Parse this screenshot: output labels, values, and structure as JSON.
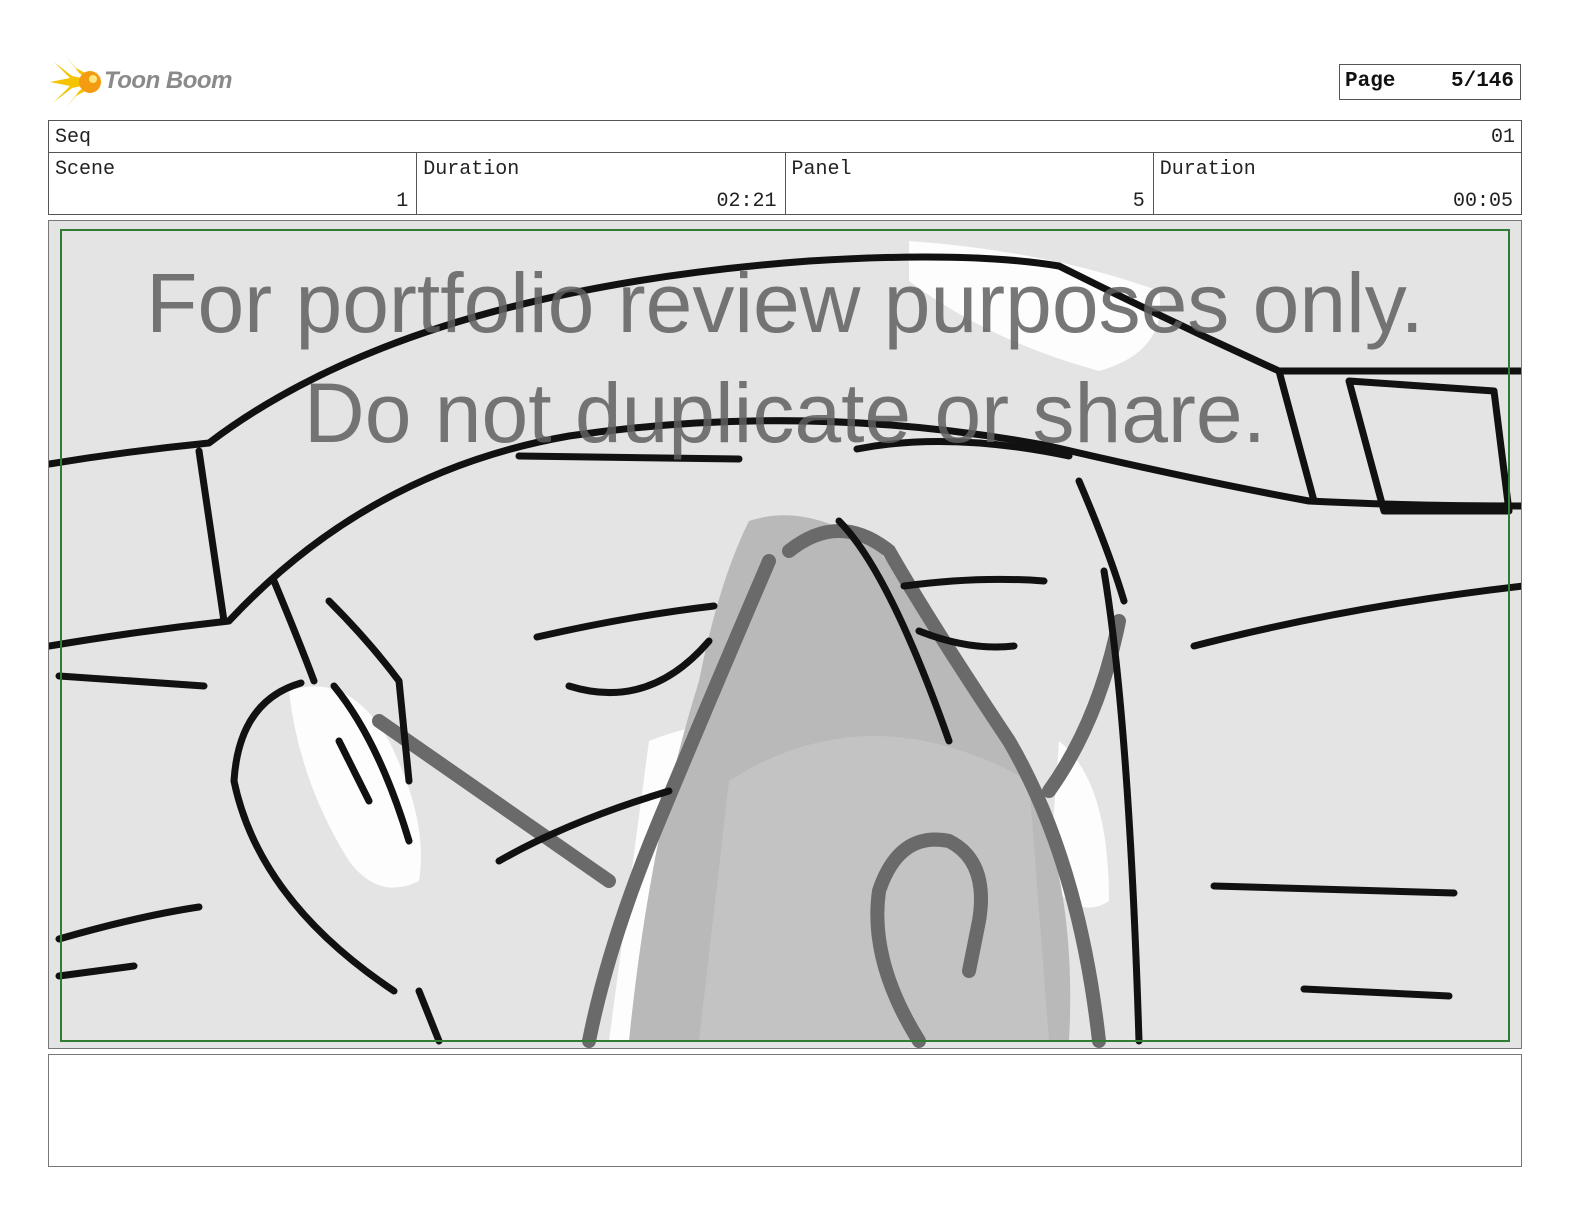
{
  "header": {
    "logo_text": "Toon Boom",
    "logo_icon": "starburst-icon",
    "page_label": "Page",
    "page_value": "5/146"
  },
  "info": {
    "seq_label": "Seq",
    "seq_value": "01",
    "cells": [
      {
        "label": "Scene",
        "value": "1"
      },
      {
        "label": "Duration",
        "value": "02:21"
      },
      {
        "label": "Panel",
        "value": "5"
      },
      {
        "label": "Duration",
        "value": "00:05"
      }
    ]
  },
  "panel": {
    "watermark_line1": "For portfolio review purposes only.",
    "watermark_line2": "Do not duplicate or share.",
    "safe_area_color": "#2e7d32"
  },
  "notes": {
    "text": ""
  }
}
